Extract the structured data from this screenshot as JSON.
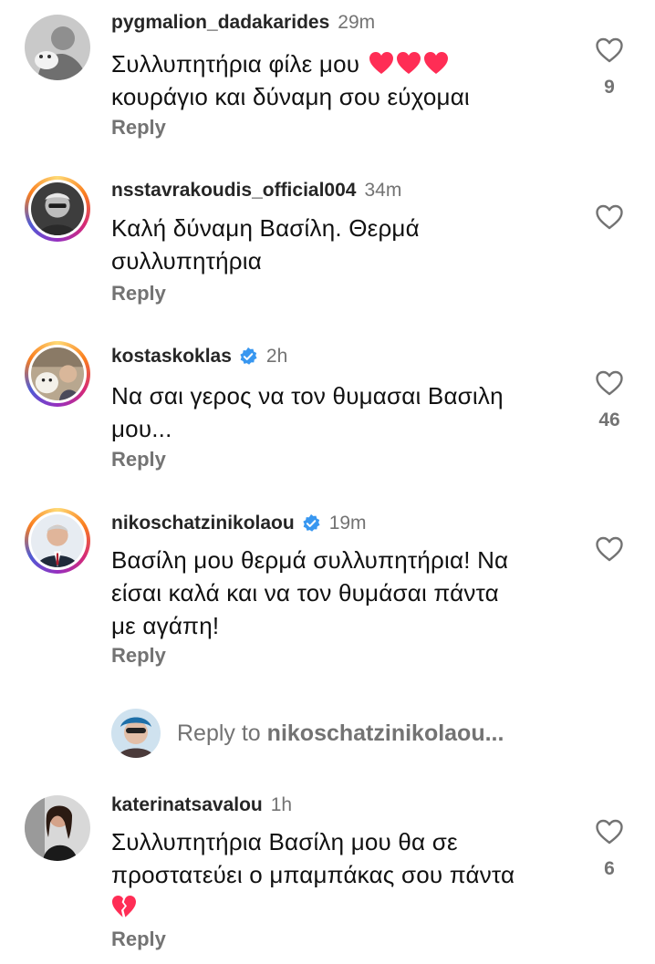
{
  "comments": [
    {
      "username": "pygmalion_dadakarides",
      "time": "29m",
      "verified": false,
      "line1": "Συλλυπητήρια φίλε μου",
      "line2": "κουράγιο και δύναμη σου εύχομαι",
      "hearts": "❤️❤️❤️",
      "likes": "9",
      "reply_label": "Reply"
    },
    {
      "username": "nsstavrakoudis_official004",
      "time": "34m",
      "verified": false,
      "line1": "Καλή δύναμη Βασίλη. Θερμά",
      "line2": "συλλυπητήρια",
      "likes": "",
      "reply_label": "Reply"
    },
    {
      "username": "kostaskoklas",
      "time": "2h",
      "verified": true,
      "line1": "Να σαι γερος να τον θυμασαι Βασιλη",
      "line2": "μου...",
      "likes": "46",
      "reply_label": "Reply"
    },
    {
      "username": "nikoschatzinikolaou",
      "time": "19m",
      "verified": true,
      "line1": "Βασίλη μου θερμά συλλυπητήρια! Να",
      "line2": "είσαι καλά και να τον θυμάσαι πάντα",
      "line3": "με αγάπη!",
      "likes": "",
      "reply_label": "Reply"
    },
    {
      "username": "katerinatsavalou",
      "time": "1h",
      "verified": false,
      "line1": "Συλλυπητήρια Βασίλη μου  θα σε",
      "line2": "προστατεύει ο μπαμπάκας σου πάντα",
      "broken_heart": "💔",
      "likes": "6",
      "reply_label": "Reply"
    }
  ],
  "reply_to": {
    "prefix": "Reply to",
    "handle": "nikoschatzinikolaou..."
  },
  "colors": {
    "text": "#111111",
    "username": "#262626",
    "muted": "#737373",
    "verified": "#3897f0",
    "heart": "#ff2d55"
  }
}
